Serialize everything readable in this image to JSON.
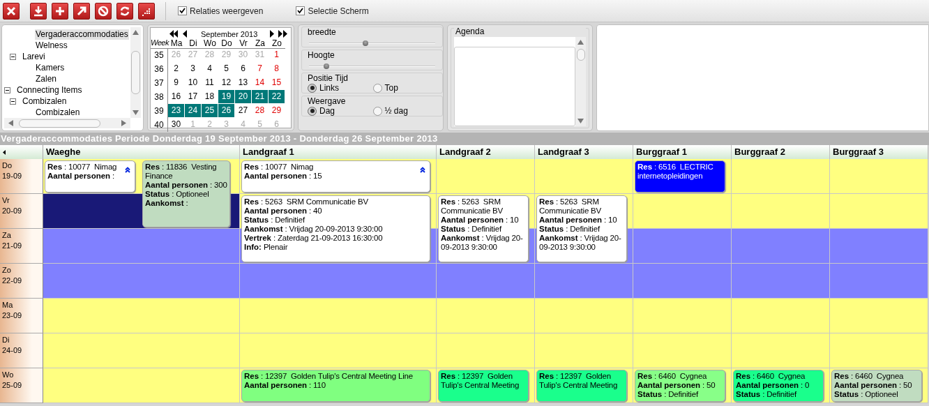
{
  "toolbar": {
    "checkboxes": [
      {
        "label": "Relaties weergeven",
        "checked": true
      },
      {
        "label": "Selectie Scherm",
        "checked": true
      }
    ]
  },
  "tree": {
    "items": [
      {
        "children": [
          {
            "children": [
              {
                "label": "Vergaderaccommodaties",
                "selected": true
              },
              {
                "label": "Welness",
                "selected": false
              }
            ]
          },
          {
            "label": "Larevi",
            "expanded": true,
            "selected": false,
            "children": [
              {
                "label": "Kamers",
                "selected": false
              },
              {
                "label": "Zalen",
                "selected": false
              }
            ]
          }
        ]
      },
      {
        "label": "Connecting Items",
        "expanded": true,
        "selected": false,
        "children": [
          {
            "label": "Combizalen",
            "expanded": true,
            "selected": false,
            "children": [
              {
                "label": "Combizalen",
                "selected": false
              }
            ]
          }
        ]
      }
    ]
  },
  "calendar": {
    "month": "September 2013",
    "week_label": "Week",
    "weekdays": [
      "Ma",
      "Di",
      "Wo",
      "Do",
      "Vr",
      "Za",
      "Zo"
    ],
    "weeks": [
      {
        "number": "35",
        "days": [
          {
            "day": "26",
            "other_month": true,
            "selected": false
          },
          {
            "day": "27",
            "other_month": true,
            "selected": false
          },
          {
            "day": "28",
            "other_month": true,
            "selected": false
          },
          {
            "day": "29",
            "other_month": true,
            "selected": false
          },
          {
            "day": "30",
            "other_month": true,
            "selected": false
          },
          {
            "day": "31",
            "other_month": true,
            "selected": false
          },
          {
            "day": "1",
            "other_month": false,
            "selected": false
          }
        ]
      },
      {
        "number": "36",
        "days": [
          {
            "day": "2",
            "other_month": false,
            "selected": false
          },
          {
            "day": "3",
            "other_month": false,
            "selected": false
          },
          {
            "day": "4",
            "other_month": false,
            "selected": false
          },
          {
            "day": "5",
            "other_month": false,
            "selected": false
          },
          {
            "day": "6",
            "other_month": false,
            "selected": false
          },
          {
            "day": "7",
            "other_month": false,
            "selected": false
          },
          {
            "day": "8",
            "other_month": false,
            "selected": false
          }
        ]
      },
      {
        "number": "37",
        "days": [
          {
            "day": "9",
            "other_month": false,
            "selected": false
          },
          {
            "day": "10",
            "other_month": false,
            "selected": false
          },
          {
            "day": "11",
            "other_month": false,
            "selected": false
          },
          {
            "day": "12",
            "other_month": false,
            "selected": false
          },
          {
            "day": "13",
            "other_month": false,
            "selected": false
          },
          {
            "day": "14",
            "other_month": false,
            "selected": false
          },
          {
            "day": "15",
            "other_month": false,
            "selected": false
          }
        ]
      },
      {
        "number": "38",
        "days": [
          {
            "day": "16",
            "other_month": false,
            "selected": false
          },
          {
            "day": "17",
            "other_month": false,
            "selected": false
          },
          {
            "day": "18",
            "other_month": false,
            "selected": false
          },
          {
            "day": "19",
            "other_month": false,
            "selected": true
          },
          {
            "day": "20",
            "other_month": false,
            "selected": true
          },
          {
            "day": "21",
            "other_month": false,
            "selected": true
          },
          {
            "day": "22",
            "other_month": false,
            "selected": true
          }
        ]
      },
      {
        "number": "39",
        "days": [
          {
            "day": "23",
            "other_month": false,
            "selected": true
          },
          {
            "day": "24",
            "other_month": false,
            "selected": true
          },
          {
            "day": "25",
            "other_month": false,
            "selected": true
          },
          {
            "day": "26",
            "other_month": false,
            "selected": true
          },
          {
            "day": "27",
            "other_month": false,
            "selected": false
          },
          {
            "day": "28",
            "other_month": false,
            "selected": false
          },
          {
            "day": "29",
            "other_month": false,
            "selected": false
          }
        ]
      },
      {
        "number": "40",
        "days": [
          {
            "day": "30",
            "other_month": false,
            "selected": false
          },
          {
            "day": "1",
            "other_month": true,
            "selected": false
          },
          {
            "day": "2",
            "other_month": true,
            "selected": false
          },
          {
            "day": "3",
            "other_month": true,
            "selected": false
          },
          {
            "day": "4",
            "other_month": true,
            "selected": false
          },
          {
            "day": "5",
            "other_month": true,
            "selected": false
          },
          {
            "day": "6",
            "other_month": true,
            "selected": false
          }
        ]
      }
    ]
  },
  "settings": {
    "sliders": [
      {
        "label": "breedte",
        "level": 0.45
      },
      {
        "label": "Hoogte",
        "level": 0.14
      }
    ],
    "radio_groups": [
      {
        "label": "Positie Tijd",
        "options": [
          {
            "label": "Links",
            "selected": true
          },
          {
            "label": "Top",
            "selected": false
          }
        ]
      },
      {
        "label": "Weergave",
        "options": [
          {
            "label": "Dag",
            "selected": true
          },
          {
            "label": "½ dag",
            "selected": false
          }
        ]
      }
    ]
  },
  "agenda": {
    "title": "Agenda"
  },
  "schedule": {
    "title": "Vergaderaccommodaties Periode Donderdag 19 September 2013 - Donderdag 26 September 2013",
    "resources": [
      {
        "name": "Waeghe",
        "kind": "wide"
      },
      {
        "name": "Landgraaf 1",
        "kind": "wide"
      },
      {
        "name": "Landgraaf 2",
        "kind": "narrow"
      },
      {
        "name": "Landgraaf 3",
        "kind": "narrow"
      },
      {
        "name": "Burggraaf 1",
        "kind": "narrow"
      },
      {
        "name": "Burggraaf 2",
        "kind": "narrow"
      },
      {
        "name": "Burggraaf 3",
        "kind": "narrow"
      }
    ],
    "days": [
      {
        "day": "Do",
        "date": "19-09",
        "weekend": false,
        "cells": [
          {
            "blocked": false,
            "reservations": [
              {
                "lines": [
                  "**Res** : 10077  Nimag",
                  "**Aantal personen** :"
                ],
                "color": "#ffffff",
                "kind": "left",
                "expand_icon": true
              },
              {
                "lines": [
                  "**Res** : 11836  Vesting Finance",
                  "**Aantal personen** : 300",
                  "**Status** : Optioneel",
                  "**Aankomst** :"
                ],
                "color": "#c0dcc0",
                "kind": "right_two_days",
                "expand_icon": false
              }
            ]
          },
          {
            "blocked": false,
            "reservations": [
              {
                "lines": [
                  "**Res** : 10077  Nimag",
                  "**Aantal personen** : 15"
                ],
                "color": "#ffffff",
                "kind": "full",
                "expand_icon": true
              }
            ]
          },
          {
            "blocked": false
          },
          {
            "blocked": false
          },
          {
            "blocked": false,
            "reservations": [
              {
                "lines": [
                  "**Res** : 6516  LECTRIC internetopleidingen"
                ],
                "color": "#0000ff",
                "kind": "full",
                "expand_icon": false
              }
            ]
          },
          {
            "blocked": false
          },
          {
            "blocked": false
          }
        ]
      },
      {
        "day": "Vr",
        "date": "20-09",
        "weekend": false,
        "cells": [
          {
            "blocked": true
          },
          {
            "blocked": false,
            "reservations": [
              {
                "lines": [
                  "**Res** : 5263  SRM Communicatie BV",
                  "**Aantal personen** : 40",
                  "**Status** : Definitief",
                  "**Aankomst** : Vrijdag 20-09-2013 9:30:00",
                  "**Vertrek** : Zaterdag 21-09-2013 16:30:00",
                  "**Info:** Plenair"
                ],
                "color": "#ffffff",
                "kind": "full_two_days",
                "expand_icon": false
              }
            ]
          },
          {
            "blocked": false,
            "reservations": [
              {
                "lines": [
                  "**Res** : 5263  SRM Communicatie BV",
                  "**Aantal personen** : 10",
                  "**Status** : Definitief",
                  "**Aankomst** : Vrijdag 20-09-2013 9:30:00"
                ],
                "color": "#ffffff",
                "kind": "full_two_days",
                "expand_icon": false
              }
            ]
          },
          {
            "blocked": false,
            "reservations": [
              {
                "lines": [
                  "**Res** : 5263  SRM Communicatie BV",
                  "**Aantal personen** : 10",
                  "**Status** : Definitief",
                  "**Aankomst** : Vrijdag 20-09-2013 9:30:00"
                ],
                "color": "#ffffff",
                "kind": "full_two_days",
                "expand_icon": false
              }
            ]
          },
          {
            "blocked": false
          },
          {
            "blocked": false
          },
          {
            "blocked": false
          }
        ]
      },
      {
        "day": "Za",
        "date": "21-09",
        "weekend": true,
        "cells": [
          {
            "blocked": false
          },
          {
            "blocked": false
          },
          {
            "blocked": false
          },
          {
            "blocked": false
          },
          {
            "blocked": false
          },
          {
            "blocked": false
          },
          {
            "blocked": false
          }
        ]
      },
      {
        "day": "Zo",
        "date": "22-09",
        "weekend": true,
        "cells": [
          {
            "blocked": false
          },
          {
            "blocked": false
          },
          {
            "blocked": false
          },
          {
            "blocked": false
          },
          {
            "blocked": false
          },
          {
            "blocked": false
          },
          {
            "blocked": false
          }
        ]
      },
      {
        "day": "Ma",
        "date": "23-09",
        "weekend": false,
        "cells": [
          {
            "blocked": false
          },
          {
            "blocked": false
          },
          {
            "blocked": false
          },
          {
            "blocked": false
          },
          {
            "blocked": false
          },
          {
            "blocked": false
          },
          {
            "blocked": false
          }
        ]
      },
      {
        "day": "Di",
        "date": "24-09",
        "weekend": false,
        "cells": [
          {
            "blocked": false
          },
          {
            "blocked": false
          },
          {
            "blocked": false
          },
          {
            "blocked": false
          },
          {
            "blocked": false
          },
          {
            "blocked": false
          },
          {
            "blocked": false
          }
        ]
      },
      {
        "day": "Wo",
        "date": "25-09",
        "weekend": false,
        "cells": [
          {
            "blocked": false
          },
          {
            "blocked": false,
            "reservations": [
              {
                "lines": [
                  "**Res** : 12397  Golden Tulip's Central Meeting Line",
                  "**Aantal personen** : 110"
                ],
                "color": "#80ff80",
                "kind": "full",
                "expand_icon": false
              }
            ]
          },
          {
            "blocked": false,
            "reservations": [
              {
                "lines": [
                  "**Res** : 12397  Golden Tulip's Central Meeting"
                ],
                "color": "#1aff8c",
                "kind": "full",
                "expand_icon": false
              }
            ]
          },
          {
            "blocked": false,
            "reservations": [
              {
                "lines": [
                  "**Res** : 12397  Golden Tulip's Central Meeting"
                ],
                "color": "#1aff8c",
                "kind": "full",
                "expand_icon": false
              }
            ]
          },
          {
            "blocked": false,
            "reservations": [
              {
                "lines": [
                  "**Res** : 6460  Cygnea",
                  "**Aantal personen** : 50",
                  "**Status** : Definitief"
                ],
                "color": "#88ff88",
                "kind": "full",
                "expand_icon": false
              }
            ]
          },
          {
            "blocked": false,
            "reservations": [
              {
                "lines": [
                  "**Res** : 6460  Cygnea",
                  "**Aantal personen** : 0",
                  "**Status** : Definitief"
                ],
                "color": "#1aff8c",
                "kind": "full",
                "expand_icon": false
              }
            ]
          },
          {
            "blocked": false,
            "reservations": [
              {
                "lines": [
                  "**Res** : 6460  Cygnea",
                  "**Aantal personen** : 50",
                  "**Status** : Optioneel"
                ],
                "color": "#c0dcc0",
                "kind": "full",
                "expand_icon": false
              }
            ]
          }
        ]
      }
    ]
  }
}
